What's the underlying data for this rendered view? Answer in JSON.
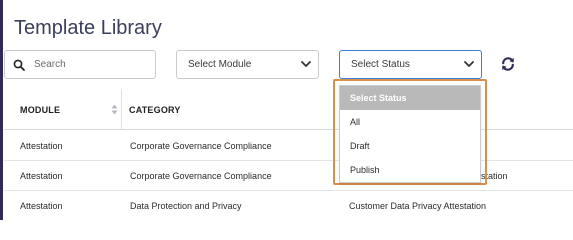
{
  "page": {
    "title": "Template Library"
  },
  "filters": {
    "search_placeholder": "Search",
    "module_select": "Select Module",
    "status_select": "Select Status"
  },
  "status_dropdown": {
    "options": [
      "Select Status",
      "All",
      "Draft",
      "Publish"
    ],
    "selected_index": 0
  },
  "table": {
    "columns": [
      "MODULE",
      "CATEGORY"
    ],
    "rows": [
      {
        "module": "Attestation",
        "category": "Corporate Governance Compliance",
        "name": ""
      },
      {
        "module": "Attestation",
        "category": "Corporate Governance Compliance",
        "name": "ttestation"
      },
      {
        "module": "Attestation",
        "category": "Data Protection and Privacy",
        "name": "Customer Data Privacy Attestation"
      }
    ]
  },
  "icons": {
    "search": "search-icon",
    "chevron": "chevron-down-icon",
    "refresh": "refresh-icon",
    "sort": "sort-icon"
  },
  "colors": {
    "accent_dark": "#2f2a57",
    "focus_border": "#3b7fd4",
    "highlight_frame": "#d98e4c",
    "selected_option_bg": "#b9b9b9"
  }
}
